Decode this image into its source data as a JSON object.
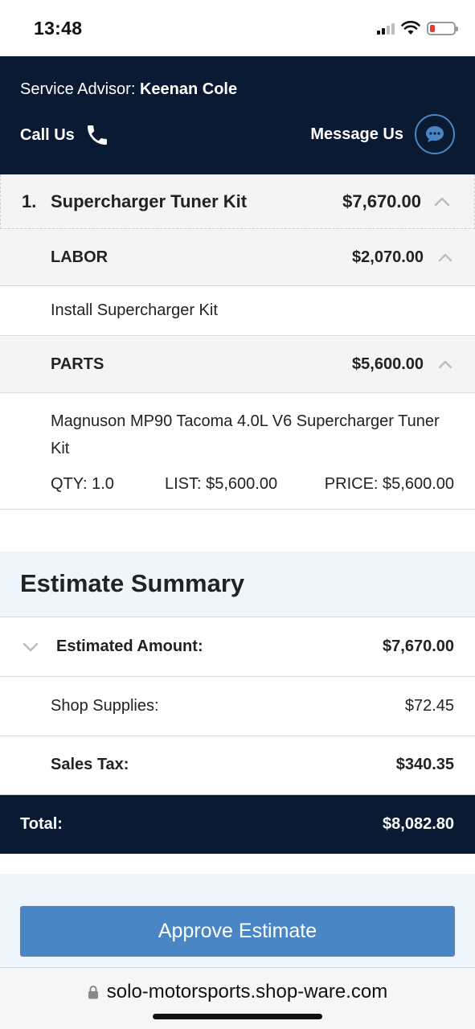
{
  "status_bar": {
    "time": "13:48"
  },
  "header": {
    "advisor_label": "Service Advisor:",
    "advisor_name": "Keenan Cole",
    "call_label": "Call Us",
    "message_label": "Message Us"
  },
  "job": {
    "number": "1.",
    "name": "Supercharger Tuner Kit",
    "price": "$7,670.00"
  },
  "labor": {
    "title": "LABOR",
    "price": "$2,070.00",
    "description": "Install Supercharger Kit"
  },
  "parts": {
    "title": "PARTS",
    "price": "$5,600.00",
    "items": [
      {
        "name": "Magnuson MP90 Tacoma 4.0L V6 Supercharger Tuner Kit",
        "qty": "QTY: 1.0",
        "list": "LIST: $5,600.00",
        "price": "PRICE: $5,600.00"
      }
    ]
  },
  "summary": {
    "title": "Estimate Summary",
    "estimated_label": "Estimated Amount:",
    "estimated_value": "$7,670.00",
    "supplies_label": "Shop Supplies:",
    "supplies_value": "$72.45",
    "tax_label": "Sales Tax:",
    "tax_value": "$340.35",
    "total_label": "Total:",
    "total_value": "$8,082.80"
  },
  "actions": {
    "approve_label": "Approve Estimate"
  },
  "browser": {
    "url": "solo-motorsports.shop-ware.com"
  },
  "colors": {
    "header_bg": "#0b1a33",
    "accent": "#4a86c5",
    "summary_bg": "#eff6fb"
  },
  "icons": {
    "phone": "phone-icon",
    "chat": "chat-bubble-icon",
    "lock": "lock-icon"
  }
}
